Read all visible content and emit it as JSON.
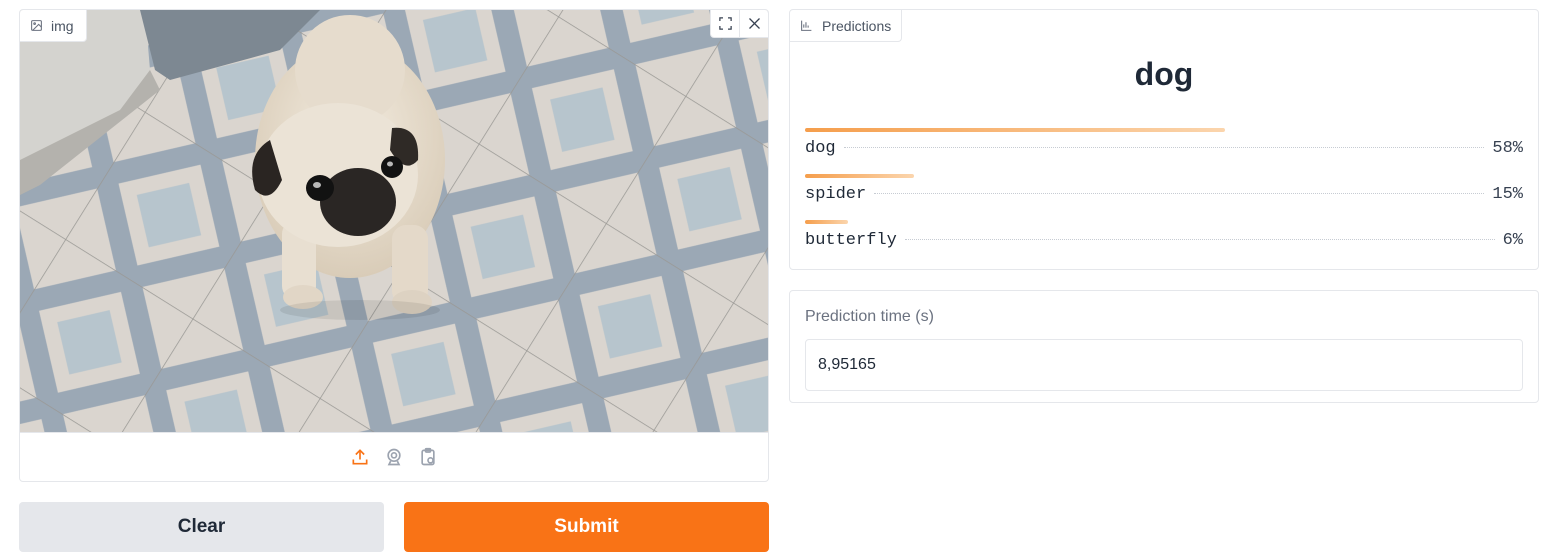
{
  "image_input": {
    "label": "img",
    "label_icon": "image-icon",
    "image_subject": "pug dog standing on patterned tile floor",
    "actions": {
      "fullscreen_icon": "fullscreen-icon",
      "close_icon": "close-icon"
    },
    "sources": [
      "upload-icon",
      "webcam-icon",
      "clipboard-icon"
    ]
  },
  "buttons": {
    "clear": "Clear",
    "submit": "Submit"
  },
  "predictions": {
    "label": "Predictions",
    "label_icon": "bar-chart-icon",
    "top_label": "dog",
    "confidences": [
      {
        "label": "dog",
        "percent": "58%",
        "fraction": 0.58
      },
      {
        "label": "spider",
        "percent": "15%",
        "fraction": 0.15
      },
      {
        "label": "butterfly",
        "percent": "6%",
        "fraction": 0.06
      }
    ]
  },
  "prediction_time": {
    "label": "Prediction time (s)",
    "value": "8,95165"
  },
  "colors": {
    "accent": "#f97316",
    "clear_bg": "#e5e7eb",
    "bar_start": "#f59e4c",
    "bar_end": "#fbd5ad"
  }
}
